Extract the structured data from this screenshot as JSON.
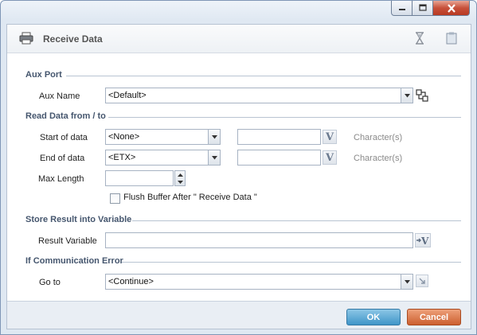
{
  "window": {
    "controls": {
      "minimize": "minimize-icon",
      "maximize": "maximize-icon",
      "close": "close-icon"
    }
  },
  "header": {
    "title": "Receive Data",
    "icons": [
      "printer-icon",
      "hourglass-icon",
      "notes-icon"
    ]
  },
  "aux_port": {
    "section_title": "Aux Port",
    "aux_name_label": "Aux Name",
    "aux_name_value": "<Default>"
  },
  "read_data": {
    "section_title": "Read Data from / to",
    "start_label": "Start of data",
    "start_value": "<None>",
    "start_text": "",
    "start_unit": "Character(s)",
    "end_label": "End of data",
    "end_value": "<ETX>",
    "end_text": "",
    "end_unit": "Character(s)",
    "max_length_label": "Max Length",
    "max_length_value": "",
    "flush_label": "Flush Buffer After \" Receive Data \"",
    "flush_checked": false
  },
  "store_result": {
    "section_title": "Store Result into Variable",
    "result_label": "Result Variable",
    "result_value": ""
  },
  "comm_error": {
    "section_title": "If Communication Error",
    "goto_label": "Go to",
    "goto_value": "<Continue>"
  },
  "footer": {
    "ok_label": "OK",
    "cancel_label": "Cancel"
  },
  "colors": {
    "ok": "#3f95c8",
    "cancel": "#cc5f2f",
    "close": "#c7503a",
    "section_title": "#45566e"
  }
}
